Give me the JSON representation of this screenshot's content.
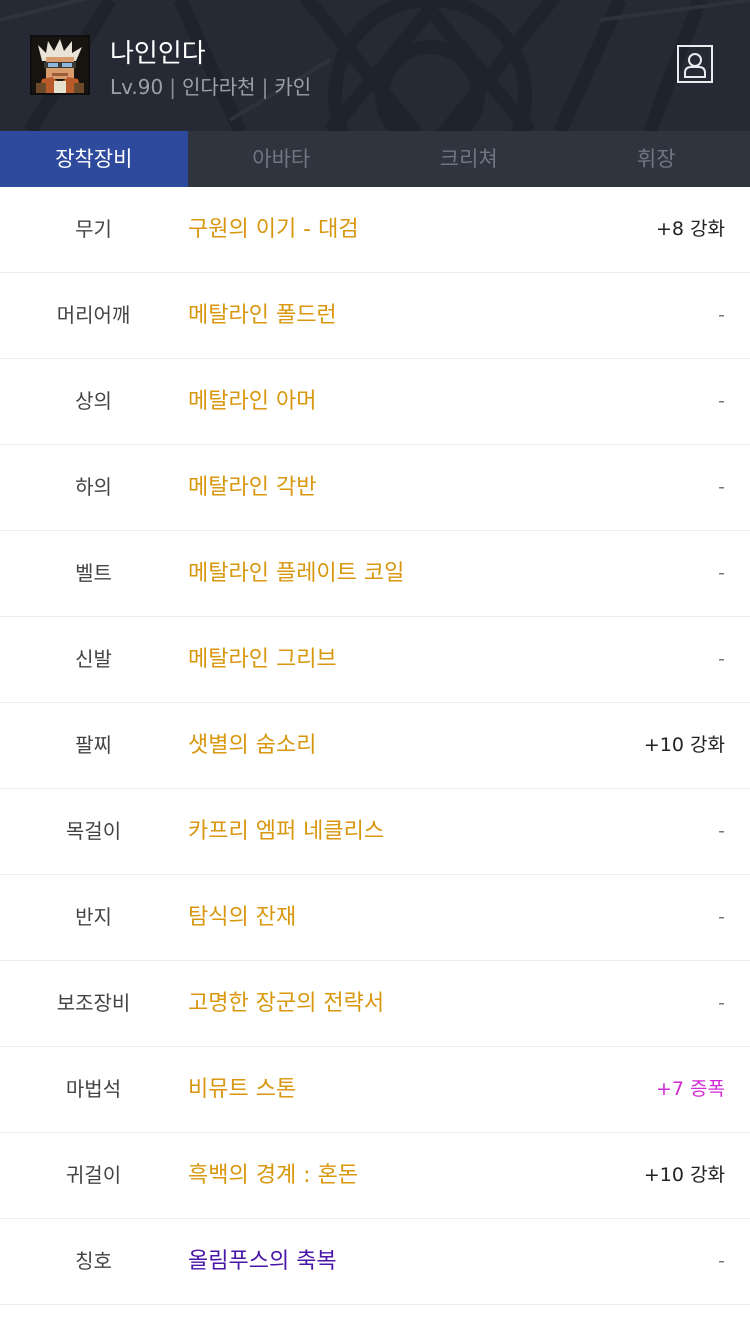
{
  "character": {
    "name": "나인인다",
    "level": "Lv.90",
    "server": "인다라천",
    "job": "카인"
  },
  "tabs": [
    {
      "label": "장착장비",
      "active": true
    },
    {
      "label": "아바타",
      "active": false
    },
    {
      "label": "크리쳐",
      "active": false
    },
    {
      "label": "휘장",
      "active": false
    }
  ],
  "equipment": [
    {
      "slot": "무기",
      "name": "구원의 이기 - 대검",
      "upgrade": "+8 강화",
      "upgrade_type": "강화"
    },
    {
      "slot": "머리어깨",
      "name": "메탈라인 폴드런",
      "upgrade": "-",
      "upgrade_type": "none"
    },
    {
      "slot": "상의",
      "name": "메탈라인 아머",
      "upgrade": "-",
      "upgrade_type": "none"
    },
    {
      "slot": "하의",
      "name": "메탈라인 각반",
      "upgrade": "-",
      "upgrade_type": "none"
    },
    {
      "slot": "벨트",
      "name": "메탈라인 플레이트 코일",
      "upgrade": "-",
      "upgrade_type": "none"
    },
    {
      "slot": "신발",
      "name": "메탈라인 그리브",
      "upgrade": "-",
      "upgrade_type": "none"
    },
    {
      "slot": "팔찌",
      "name": "샛별의 숨소리",
      "upgrade": "+10 강화",
      "upgrade_type": "강화"
    },
    {
      "slot": "목걸이",
      "name": "카프리 엠퍼 네클리스",
      "upgrade": "-",
      "upgrade_type": "none"
    },
    {
      "slot": "반지",
      "name": "탐식의 잔재",
      "upgrade": "-",
      "upgrade_type": "none"
    },
    {
      "slot": "보조장비",
      "name": "고명한 장군의 전략서",
      "upgrade": "-",
      "upgrade_type": "none"
    },
    {
      "slot": "마법석",
      "name": "비뮤트 스톤",
      "upgrade": "+7 증폭",
      "upgrade_type": "증폭"
    },
    {
      "slot": "귀걸이",
      "name": "흑백의 경계 : 혼돈",
      "upgrade": "+10 강화",
      "upgrade_type": "강화"
    },
    {
      "slot": "칭호",
      "name": "올림푸스의 축복",
      "upgrade": "-",
      "upgrade_type": "none",
      "rarity": "rare"
    }
  ],
  "colors": {
    "header_bg": "#252a35",
    "tab_active_bg": "#2d4a9c",
    "item_name": "#d8970e",
    "item_name_rare": "#4a16a8",
    "amplify": "#d22ad5"
  },
  "icons": {
    "profile": "profile-icon"
  }
}
